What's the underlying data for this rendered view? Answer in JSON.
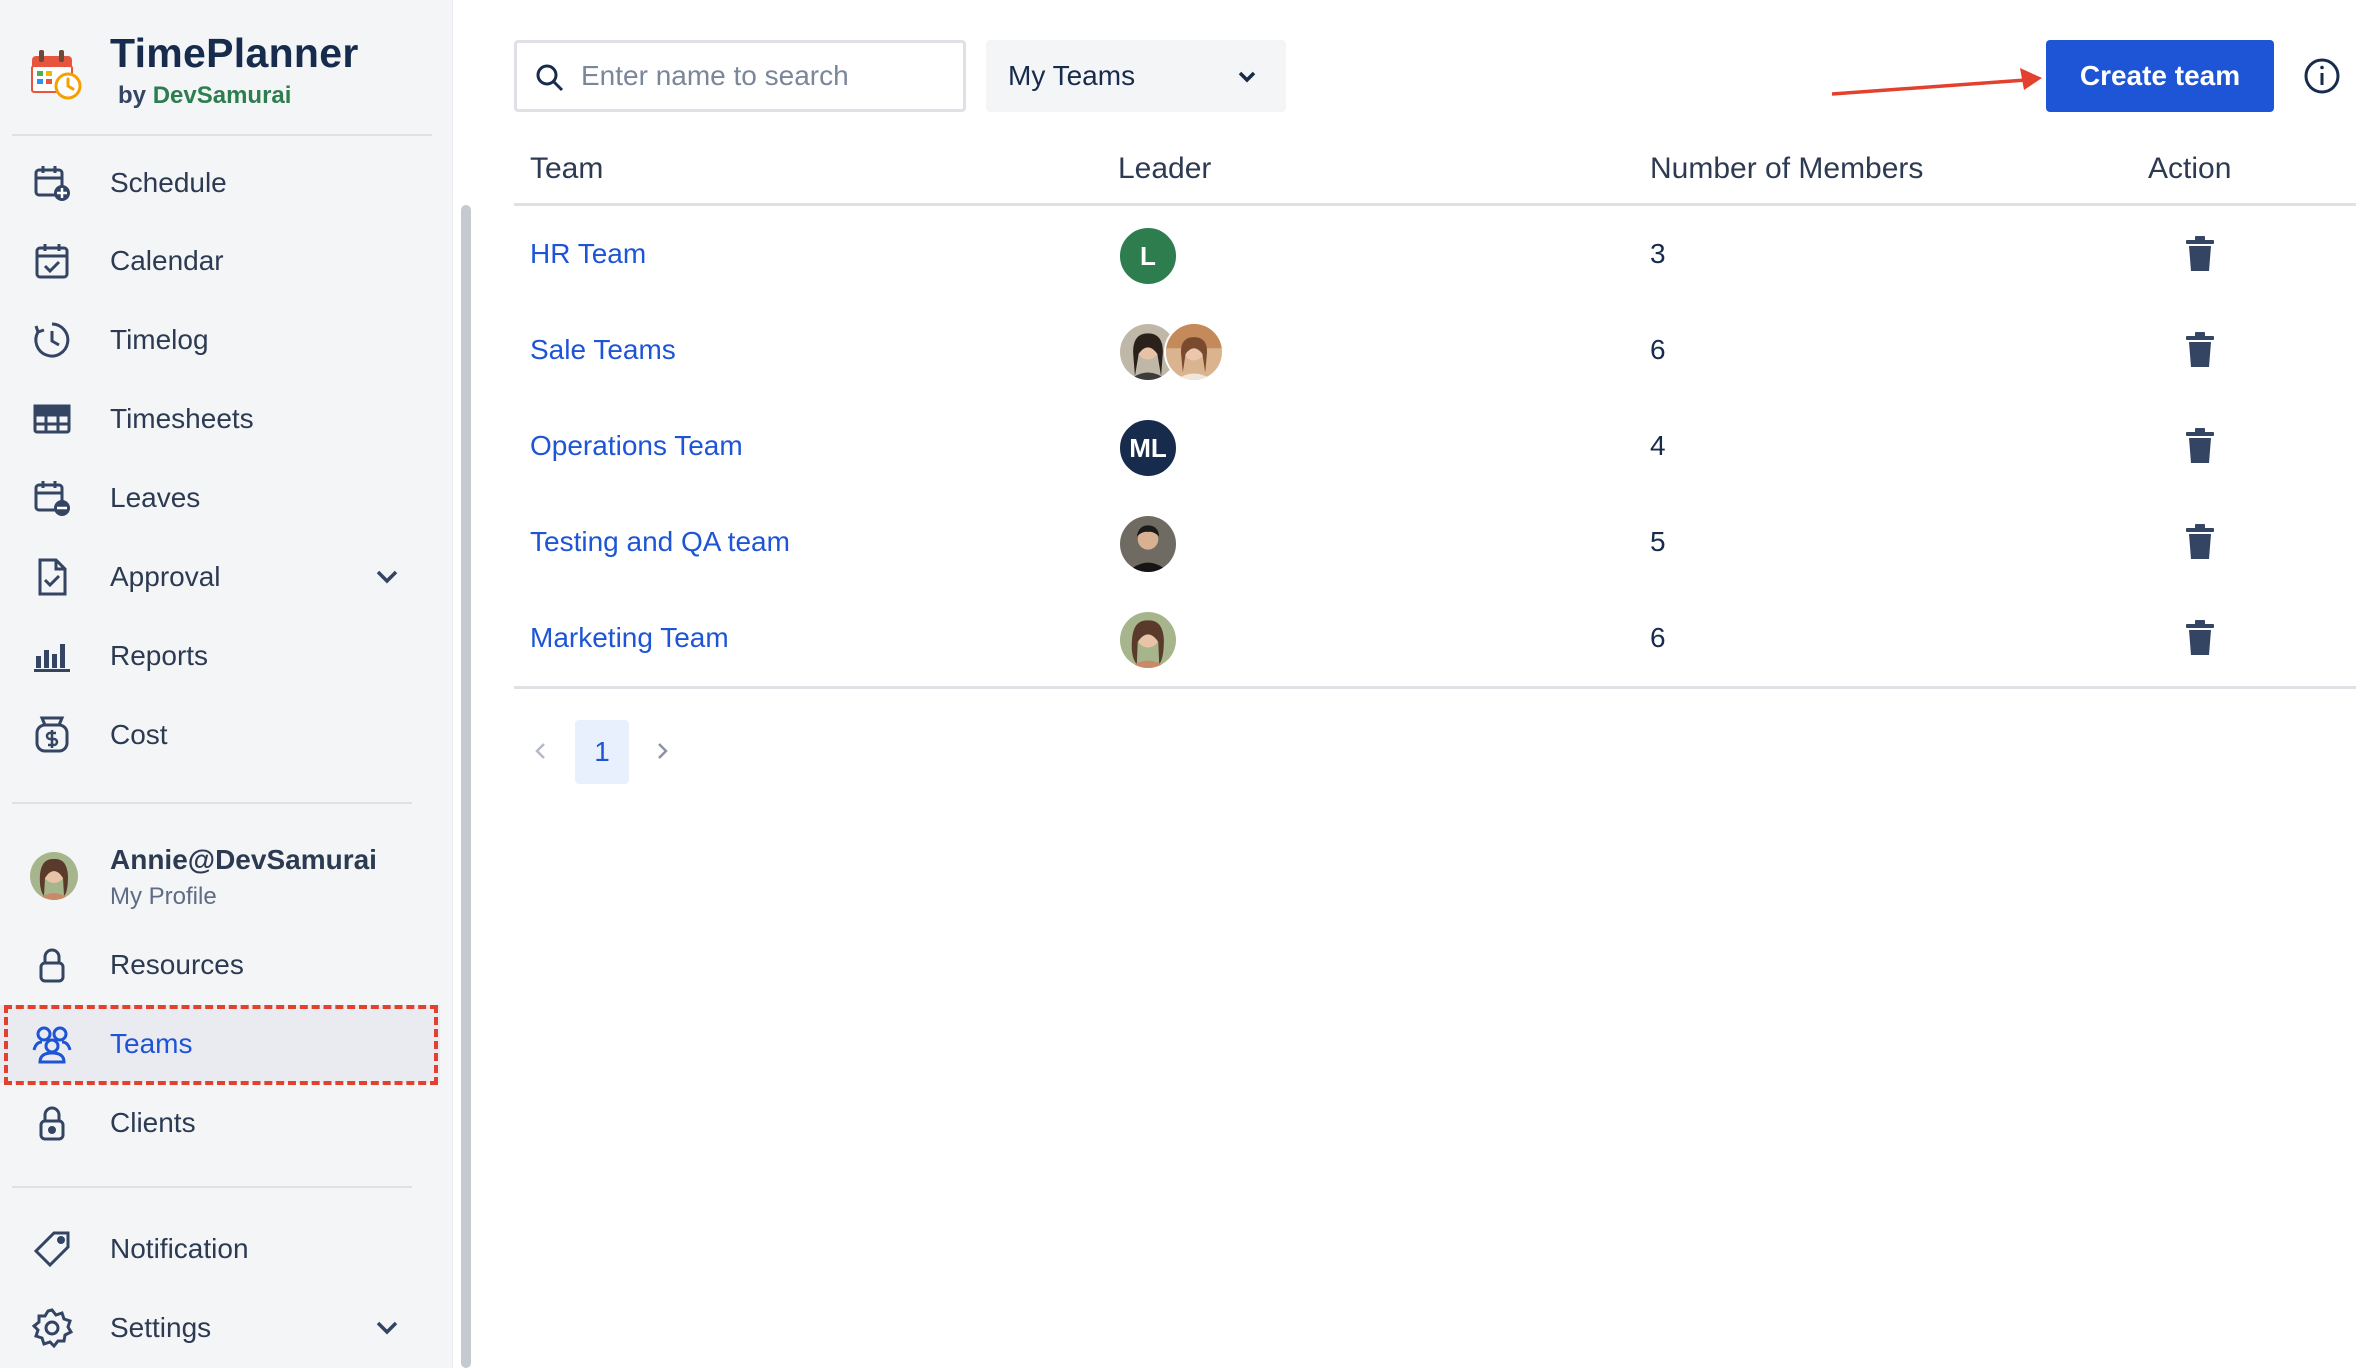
{
  "app": {
    "title": "TimePlanner",
    "by": "by",
    "vendor": "DevSamurai"
  },
  "sidebar": {
    "nav": [
      {
        "label": "Schedule",
        "icon": "calendar-plus-icon"
      },
      {
        "label": "Calendar",
        "icon": "calendar-check-icon"
      },
      {
        "label": "Timelog",
        "icon": "clock-icon"
      },
      {
        "label": "Timesheets",
        "icon": "grid-icon"
      },
      {
        "label": "Leaves",
        "icon": "calendar-minus-icon"
      },
      {
        "label": "Approval",
        "icon": "document-check-icon",
        "expandable": true
      },
      {
        "label": "Reports",
        "icon": "bar-chart-icon"
      },
      {
        "label": "Cost",
        "icon": "money-bag-icon"
      }
    ],
    "profile": {
      "name": "Annie@DevSamurai",
      "sub": "My Profile"
    },
    "admin": [
      {
        "label": "Resources",
        "icon": "lock-icon"
      },
      {
        "label": "Teams",
        "icon": "people-icon",
        "active": true
      },
      {
        "label": "Clients",
        "icon": "lock-icon"
      }
    ],
    "system": [
      {
        "label": "Notification",
        "icon": "tag-icon"
      },
      {
        "label": "Settings",
        "icon": "gear-icon",
        "expandable": true
      }
    ]
  },
  "toolbar": {
    "search_placeholder": "Enter name to search",
    "search_value": "",
    "filter_value": "My Teams",
    "create_label": "Create team"
  },
  "table": {
    "headers": [
      "Team",
      "Leader",
      "Number of Members",
      "Action"
    ],
    "rows": [
      {
        "team": "HR Team",
        "leaders": [
          {
            "initials": "L",
            "color": "#2e7d4f"
          }
        ],
        "members": "3"
      },
      {
        "team": "Sale Teams",
        "leaders": [
          {
            "photo": "woman-1"
          },
          {
            "photo": "woman-2"
          }
        ],
        "members": "6"
      },
      {
        "team": "Operations Team",
        "leaders": [
          {
            "initials": "ML",
            "color": "#172b4d"
          }
        ],
        "members": "4"
      },
      {
        "team": "Testing and QA team",
        "leaders": [
          {
            "photo": "man-1"
          }
        ],
        "members": "5"
      },
      {
        "team": "Marketing Team",
        "leaders": [
          {
            "photo": "woman-3"
          }
        ],
        "members": "6"
      }
    ]
  },
  "pagination": {
    "current": "1"
  },
  "colors": {
    "accent": "#1d55d6",
    "highlight": "#e3402e",
    "sidebar_bg": "#f4f5f7"
  }
}
